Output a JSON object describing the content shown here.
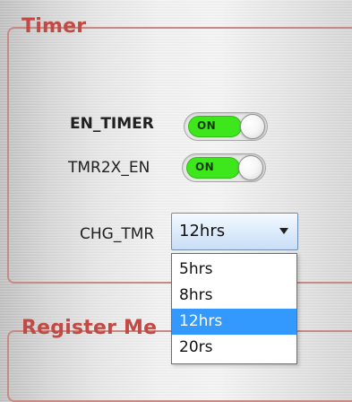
{
  "timer_group": {
    "title": "Timer",
    "en_timer": {
      "label": "EN_TIMER",
      "toggle_text": "ON"
    },
    "tmr2x_en": {
      "label": "TMR2X_EN",
      "toggle_text": "ON"
    },
    "chg_tmr": {
      "label": "CHG_TMR",
      "selected_value": "12hrs",
      "options": [
        "5hrs",
        "8hrs",
        "12hrs",
        "20rs"
      ]
    }
  },
  "register_group": {
    "title": "Register Me"
  },
  "colors": {
    "group_title": "#c24a44",
    "group_border": "#c78a84",
    "toggle_on": "#3ee61c",
    "dropdown_highlight": "#3399ff"
  },
  "icons": {
    "dropdown_arrow": "chevron-down-icon"
  }
}
